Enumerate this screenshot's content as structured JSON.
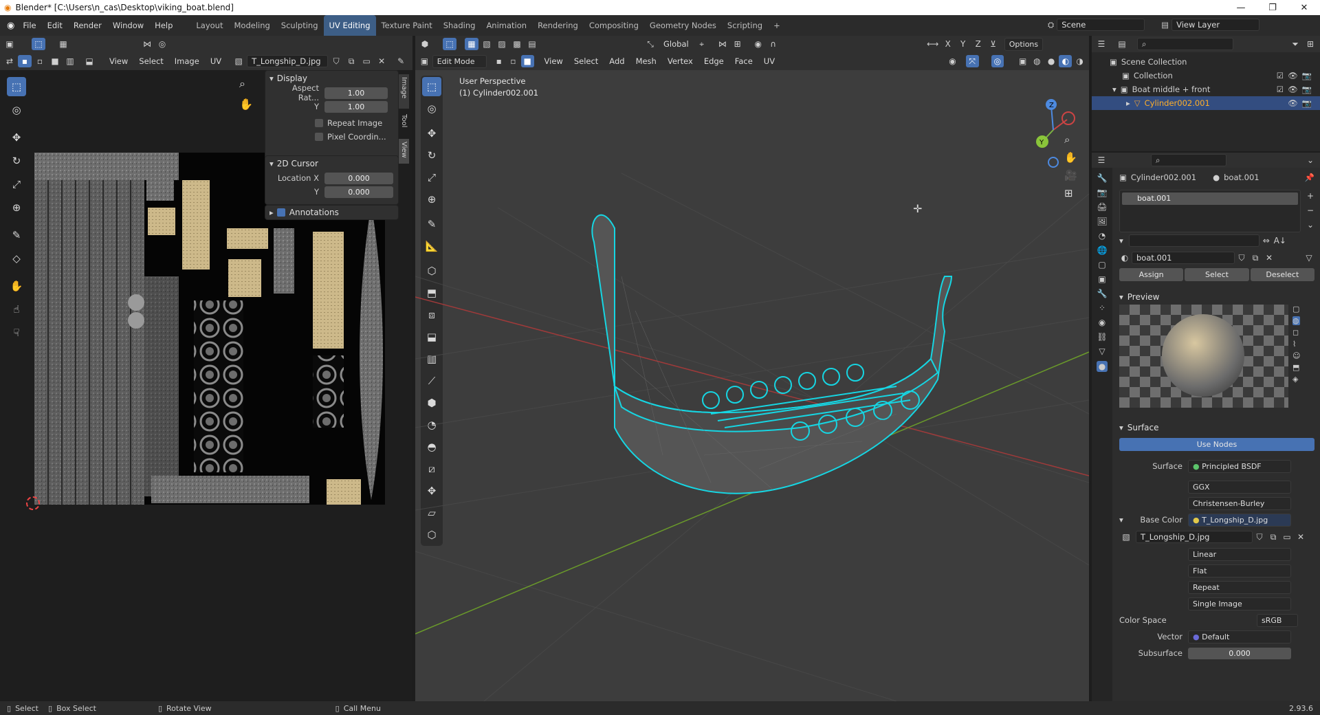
{
  "window": {
    "title": "Blender* [C:\\Users\\n_cas\\Desktop\\viking_boat.blend]",
    "minimize": "—",
    "maximize": "❐",
    "close": "✕"
  },
  "menu": [
    "File",
    "Edit",
    "Render",
    "Window",
    "Help"
  ],
  "workspaces": [
    "Layout",
    "Modeling",
    "Sculpting",
    "UV Editing",
    "Texture Paint",
    "Shading",
    "Animation",
    "Rendering",
    "Compositing",
    "Geometry Nodes",
    "Scripting"
  ],
  "scene": {
    "label": "Scene",
    "view_layer": "View Layer"
  },
  "uv_editor": {
    "menus": [
      "View",
      "Select",
      "Image",
      "UV"
    ],
    "image_name": "T_Longship_D.jpg",
    "tabs": [
      "Image",
      "Tool",
      "View"
    ],
    "display": {
      "title": "Display",
      "aspect_label": "Aspect Rat...",
      "aspect_x": "1.00",
      "y_label": "Y",
      "aspect_y": "1.00",
      "repeat": "Repeat Image",
      "pixel": "Pixel Coordin..."
    },
    "cursor": {
      "title": "2D Cursor",
      "loc_label": "Location X",
      "loc_x": "0.000",
      "y_label": "Y",
      "loc_y": "0.000"
    },
    "annotations": "Annotations"
  },
  "viewport": {
    "mode": "Edit Mode",
    "menus": [
      "View",
      "Select",
      "Add",
      "Mesh",
      "Vertex",
      "Edge",
      "Face",
      "UV"
    ],
    "orientation": "Global",
    "options": "Options",
    "perspective": "User Perspective",
    "object": "(1) Cylinder002.001",
    "axes": {
      "x": "X",
      "y": "Y",
      "z": "Z"
    }
  },
  "outliner": {
    "items": [
      {
        "label": "Scene Collection"
      },
      {
        "label": "Collection"
      },
      {
        "label": "Boat middle + front"
      },
      {
        "label": "Cylinder002.001"
      }
    ]
  },
  "properties": {
    "object_name": "Cylinder002.001",
    "material_name": "boat.001",
    "slot": "boat.001",
    "mat_field": "boat.001",
    "buttons": [
      "Assign",
      "Select",
      "Deselect"
    ],
    "preview_title": "Preview",
    "surface_title": "Surface",
    "use_nodes": "Use Nodes",
    "surface_label": "Surface",
    "surface_value": "Principled BSDF",
    "distribution": "GGX",
    "subsurface_method": "Christensen-Burley",
    "base_color_label": "Base Color",
    "base_color_value": "T_Longship_D.jpg",
    "image_name": "T_Longship_D.jpg",
    "interpolation": "Linear",
    "projection": "Flat",
    "extension": "Repeat",
    "source": "Single Image",
    "color_space_label": "Color Space",
    "color_space": "sRGB",
    "vector_label": "Vector",
    "vector_value": "Default",
    "subsurface_label": "Subsurface",
    "subsurface_value": "0.000"
  },
  "statusbar": {
    "select": "Select",
    "box_select": "Box Select",
    "rotate": "Rotate View",
    "call_menu": "Call Menu",
    "version": "2.93.6"
  },
  "colors": {
    "accent": "#4772b3",
    "wire": "#16d6e3",
    "bg": "#3d3d3d"
  }
}
